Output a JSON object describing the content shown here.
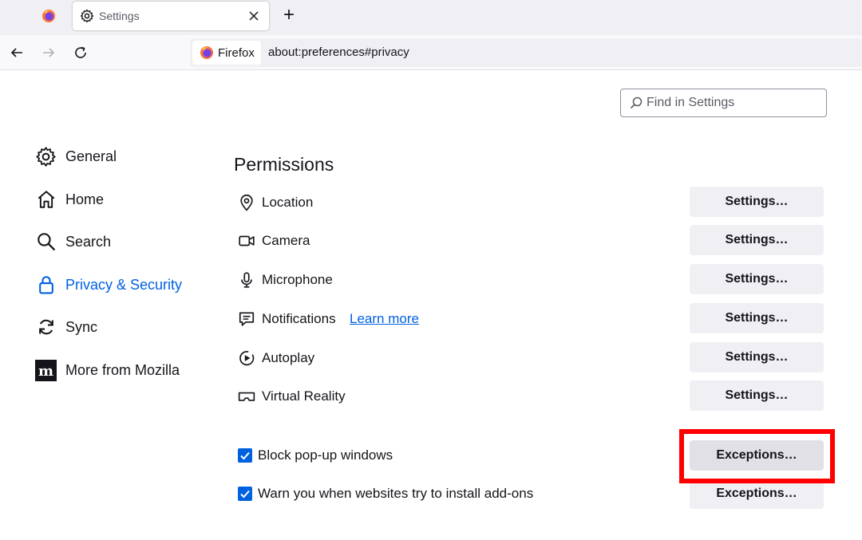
{
  "tabs": {
    "active_title": "Settings",
    "new_tab_symbol": "+"
  },
  "navbar": {
    "identity_label": "Firefox",
    "url": "about:preferences#privacy"
  },
  "search": {
    "placeholder": "Find in Settings"
  },
  "sidebar": {
    "items": [
      {
        "label": "General",
        "icon": "gear-icon"
      },
      {
        "label": "Home",
        "icon": "home-icon"
      },
      {
        "label": "Search",
        "icon": "search-icon"
      },
      {
        "label": "Privacy & Security",
        "icon": "lock-icon",
        "active": true
      },
      {
        "label": "Sync",
        "icon": "sync-icon"
      },
      {
        "label": "More from Mozilla",
        "icon": "mozilla-icon"
      }
    ]
  },
  "permissions": {
    "title": "Permissions",
    "rows": [
      {
        "label": "Location",
        "icon": "location-icon",
        "button": "Settings…"
      },
      {
        "label": "Camera",
        "icon": "camera-icon",
        "button": "Settings…"
      },
      {
        "label": "Microphone",
        "icon": "microphone-icon",
        "button": "Settings…"
      },
      {
        "label": "Notifications",
        "icon": "notifications-icon",
        "button": "Settings…",
        "link": "Learn more"
      },
      {
        "label": "Autoplay",
        "icon": "autoplay-icon",
        "button": "Settings…"
      },
      {
        "label": "Virtual Reality",
        "icon": "vr-icon",
        "button": "Settings…"
      }
    ],
    "checks": [
      {
        "label": "Block pop-up windows",
        "checked": true,
        "button": "Exceptions…"
      },
      {
        "label": "Warn you when websites try to install add-ons",
        "checked": true,
        "button": "Exceptions…"
      }
    ]
  },
  "colors": {
    "accent": "#0061e0",
    "highlight": "#ff0000",
    "button_bg": "#f0f0f4"
  }
}
